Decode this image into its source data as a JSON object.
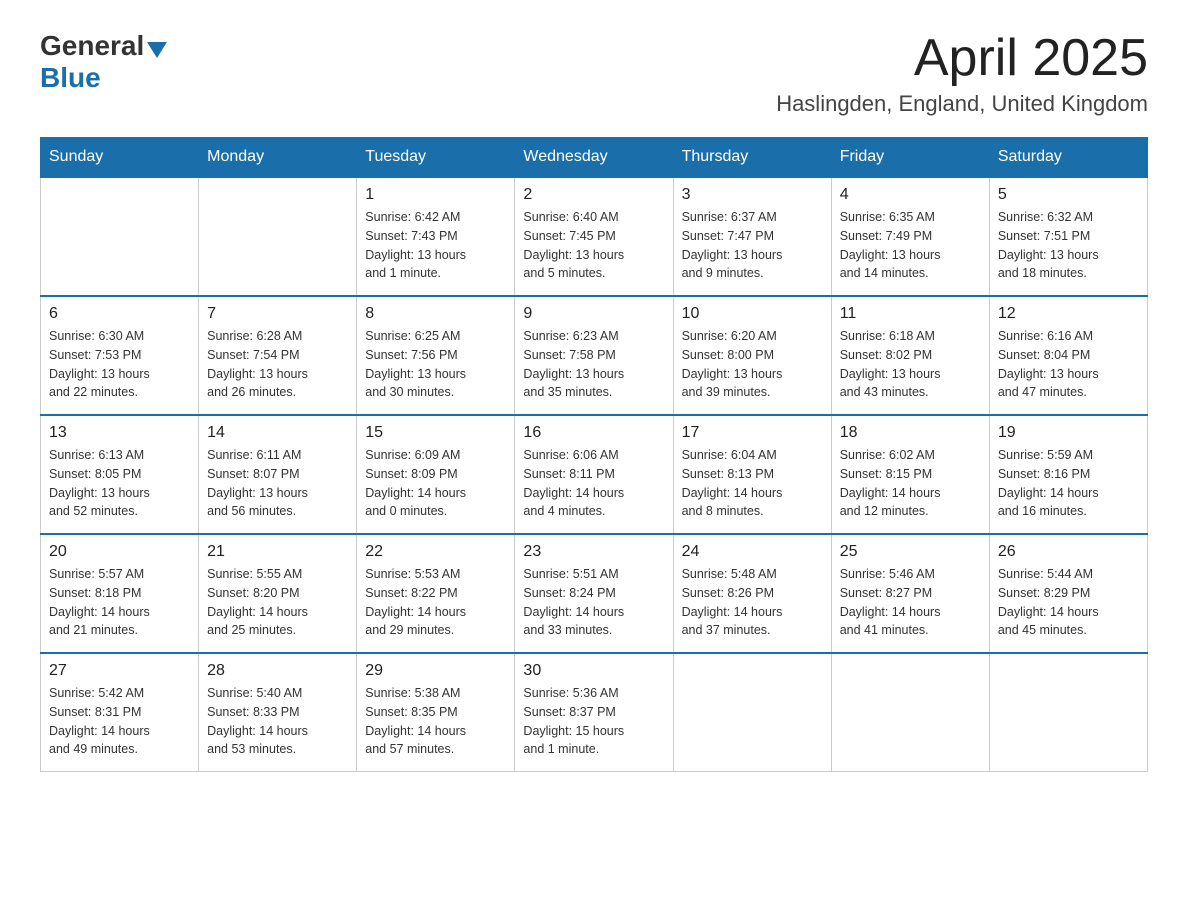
{
  "header": {
    "logo_general": "General",
    "logo_blue": "Blue",
    "month_title": "April 2025",
    "location": "Haslingden, England, United Kingdom"
  },
  "days_of_week": [
    "Sunday",
    "Monday",
    "Tuesday",
    "Wednesday",
    "Thursday",
    "Friday",
    "Saturday"
  ],
  "weeks": [
    [
      {
        "day": "",
        "info": ""
      },
      {
        "day": "",
        "info": ""
      },
      {
        "day": "1",
        "info": "Sunrise: 6:42 AM\nSunset: 7:43 PM\nDaylight: 13 hours\nand 1 minute."
      },
      {
        "day": "2",
        "info": "Sunrise: 6:40 AM\nSunset: 7:45 PM\nDaylight: 13 hours\nand 5 minutes."
      },
      {
        "day": "3",
        "info": "Sunrise: 6:37 AM\nSunset: 7:47 PM\nDaylight: 13 hours\nand 9 minutes."
      },
      {
        "day": "4",
        "info": "Sunrise: 6:35 AM\nSunset: 7:49 PM\nDaylight: 13 hours\nand 14 minutes."
      },
      {
        "day": "5",
        "info": "Sunrise: 6:32 AM\nSunset: 7:51 PM\nDaylight: 13 hours\nand 18 minutes."
      }
    ],
    [
      {
        "day": "6",
        "info": "Sunrise: 6:30 AM\nSunset: 7:53 PM\nDaylight: 13 hours\nand 22 minutes."
      },
      {
        "day": "7",
        "info": "Sunrise: 6:28 AM\nSunset: 7:54 PM\nDaylight: 13 hours\nand 26 minutes."
      },
      {
        "day": "8",
        "info": "Sunrise: 6:25 AM\nSunset: 7:56 PM\nDaylight: 13 hours\nand 30 minutes."
      },
      {
        "day": "9",
        "info": "Sunrise: 6:23 AM\nSunset: 7:58 PM\nDaylight: 13 hours\nand 35 minutes."
      },
      {
        "day": "10",
        "info": "Sunrise: 6:20 AM\nSunset: 8:00 PM\nDaylight: 13 hours\nand 39 minutes."
      },
      {
        "day": "11",
        "info": "Sunrise: 6:18 AM\nSunset: 8:02 PM\nDaylight: 13 hours\nand 43 minutes."
      },
      {
        "day": "12",
        "info": "Sunrise: 6:16 AM\nSunset: 8:04 PM\nDaylight: 13 hours\nand 47 minutes."
      }
    ],
    [
      {
        "day": "13",
        "info": "Sunrise: 6:13 AM\nSunset: 8:05 PM\nDaylight: 13 hours\nand 52 minutes."
      },
      {
        "day": "14",
        "info": "Sunrise: 6:11 AM\nSunset: 8:07 PM\nDaylight: 13 hours\nand 56 minutes."
      },
      {
        "day": "15",
        "info": "Sunrise: 6:09 AM\nSunset: 8:09 PM\nDaylight: 14 hours\nand 0 minutes."
      },
      {
        "day": "16",
        "info": "Sunrise: 6:06 AM\nSunset: 8:11 PM\nDaylight: 14 hours\nand 4 minutes."
      },
      {
        "day": "17",
        "info": "Sunrise: 6:04 AM\nSunset: 8:13 PM\nDaylight: 14 hours\nand 8 minutes."
      },
      {
        "day": "18",
        "info": "Sunrise: 6:02 AM\nSunset: 8:15 PM\nDaylight: 14 hours\nand 12 minutes."
      },
      {
        "day": "19",
        "info": "Sunrise: 5:59 AM\nSunset: 8:16 PM\nDaylight: 14 hours\nand 16 minutes."
      }
    ],
    [
      {
        "day": "20",
        "info": "Sunrise: 5:57 AM\nSunset: 8:18 PM\nDaylight: 14 hours\nand 21 minutes."
      },
      {
        "day": "21",
        "info": "Sunrise: 5:55 AM\nSunset: 8:20 PM\nDaylight: 14 hours\nand 25 minutes."
      },
      {
        "day": "22",
        "info": "Sunrise: 5:53 AM\nSunset: 8:22 PM\nDaylight: 14 hours\nand 29 minutes."
      },
      {
        "day": "23",
        "info": "Sunrise: 5:51 AM\nSunset: 8:24 PM\nDaylight: 14 hours\nand 33 minutes."
      },
      {
        "day": "24",
        "info": "Sunrise: 5:48 AM\nSunset: 8:26 PM\nDaylight: 14 hours\nand 37 minutes."
      },
      {
        "day": "25",
        "info": "Sunrise: 5:46 AM\nSunset: 8:27 PM\nDaylight: 14 hours\nand 41 minutes."
      },
      {
        "day": "26",
        "info": "Sunrise: 5:44 AM\nSunset: 8:29 PM\nDaylight: 14 hours\nand 45 minutes."
      }
    ],
    [
      {
        "day": "27",
        "info": "Sunrise: 5:42 AM\nSunset: 8:31 PM\nDaylight: 14 hours\nand 49 minutes."
      },
      {
        "day": "28",
        "info": "Sunrise: 5:40 AM\nSunset: 8:33 PM\nDaylight: 14 hours\nand 53 minutes."
      },
      {
        "day": "29",
        "info": "Sunrise: 5:38 AM\nSunset: 8:35 PM\nDaylight: 14 hours\nand 57 minutes."
      },
      {
        "day": "30",
        "info": "Sunrise: 5:36 AM\nSunset: 8:37 PM\nDaylight: 15 hours\nand 1 minute."
      },
      {
        "day": "",
        "info": ""
      },
      {
        "day": "",
        "info": ""
      },
      {
        "day": "",
        "info": ""
      }
    ]
  ]
}
